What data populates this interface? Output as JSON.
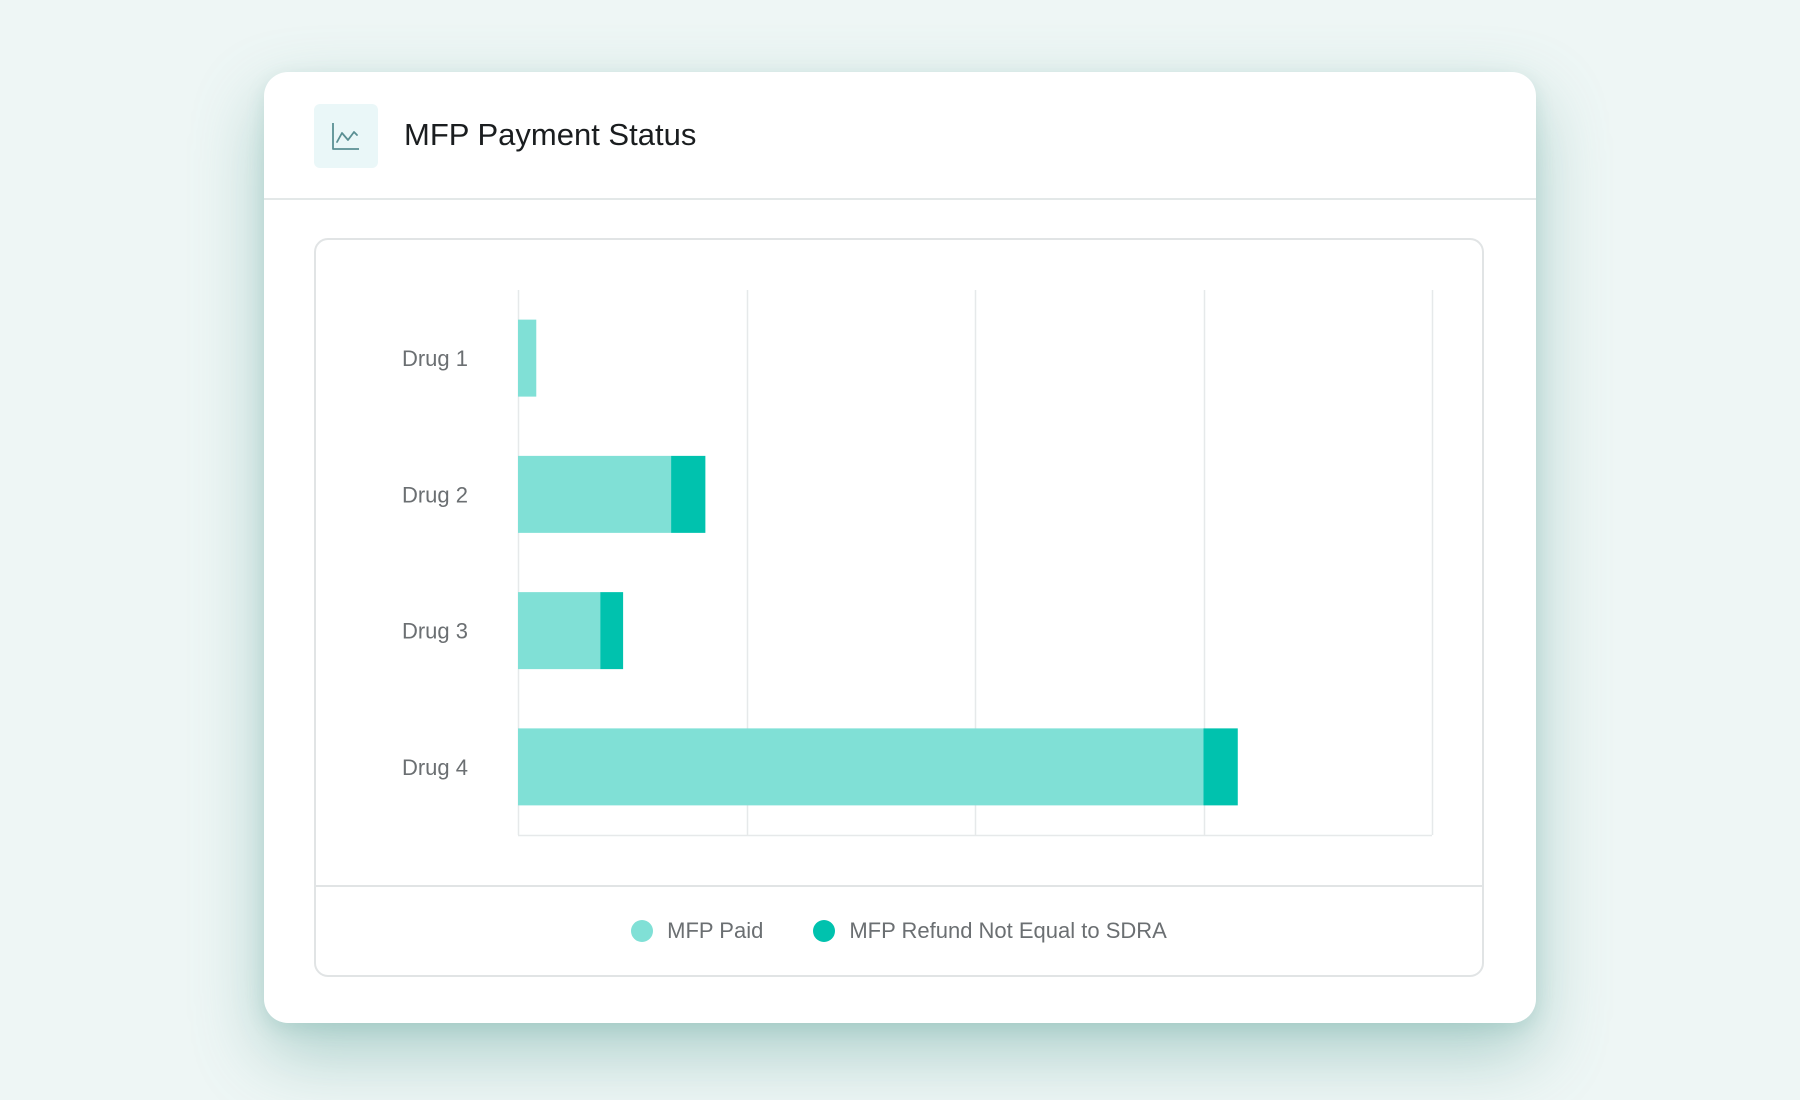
{
  "header": {
    "icon": "line-chart-icon",
    "title": "MFP Payment Status"
  },
  "colors": {
    "mfp_paid": "#80e0d6",
    "mfp_refund": "#00c2ae",
    "gridline": "#e6e9ea",
    "icon_stroke": "#5a8f93"
  },
  "chart_data": {
    "type": "bar",
    "orientation": "horizontal",
    "stacked": true,
    "categories": [
      "Drug 1",
      "Drug 2",
      "Drug 3",
      "Drug 4"
    ],
    "series": [
      {
        "name": "MFP Paid",
        "values": [
          0.08,
          0.67,
          0.36,
          3.0
        ]
      },
      {
        "name": "MFP Refund Not Equal to SDRA",
        "values": [
          0,
          0.15,
          0.1,
          0.15
        ]
      }
    ],
    "xlim": [
      0,
      4
    ],
    "x_gridlines": [
      0,
      1,
      2,
      3,
      4
    ],
    "grid": true,
    "legend_position": "bottom-center",
    "xlabel": "",
    "ylabel": ""
  }
}
